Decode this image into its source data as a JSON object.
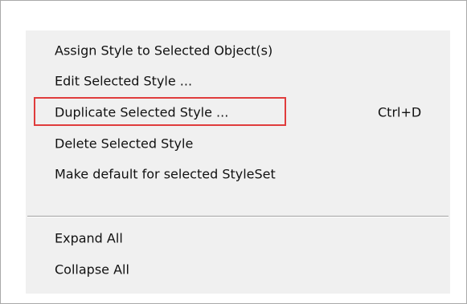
{
  "menu": {
    "items": [
      {
        "label": "Assign Style to Selected Object(s)",
        "shortcut": ""
      },
      {
        "label": "Edit Selected Style ...",
        "shortcut": ""
      },
      {
        "label": "Duplicate Selected Style ...",
        "shortcut": "Ctrl+D",
        "highlighted": true
      },
      {
        "label": "Delete Selected Style",
        "shortcut": ""
      },
      {
        "label": "Make default for selected StyleSet",
        "shortcut": ""
      },
      {
        "label": "Expand All",
        "shortcut": ""
      },
      {
        "label": "Collapse All",
        "shortcut": ""
      }
    ],
    "highlight_color": "#e03c3c",
    "background_color": "#f0f0f0"
  }
}
